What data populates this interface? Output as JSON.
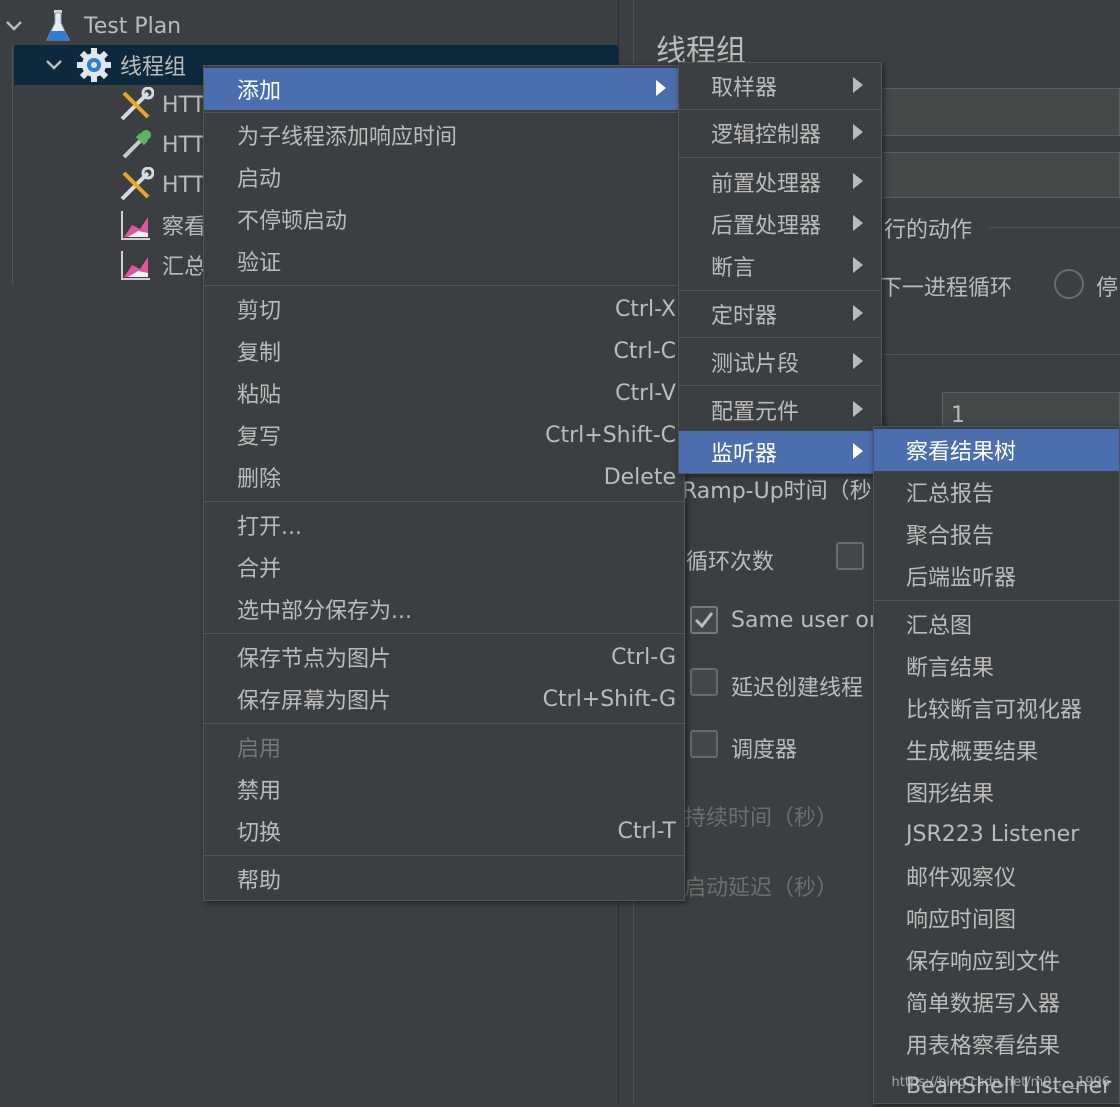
{
  "tree": {
    "root_label": "Test Plan",
    "thread_group_label": "线程组",
    "children": [
      {
        "label": "HTT",
        "icon": "sampler-tools-icon"
      },
      {
        "label": "HTT",
        "icon": "pipette-icon"
      },
      {
        "label": "HTT",
        "icon": "sampler-tools-icon"
      },
      {
        "label": "察看",
        "icon": "listener-chart-icon"
      },
      {
        "label": "汇总",
        "icon": "listener-chart-icon"
      }
    ]
  },
  "right_panel": {
    "title": "线程组",
    "action_group_label": "行的动作",
    "next_loop_label": "下一进程循环",
    "stop_label": "停",
    "threads_value": "1",
    "rampup_label": "Ramp-Up时间（秒",
    "loop_label": "循环次数",
    "same_user_label": "Same user on",
    "delay_label": "延迟创建线程",
    "scheduler_label": "调度器",
    "duration_label": "持续时间（秒）",
    "startup_delay_label": "启动延迟（秒）"
  },
  "context_menu": {
    "items": [
      {
        "label": "添加",
        "submenu": true,
        "highlight": true
      },
      {
        "label": "为子线程添加响应时间"
      },
      {
        "label": "启动"
      },
      {
        "label": "不停顿启动"
      },
      {
        "label": "验证"
      },
      {
        "label": "剪切",
        "shortcut": "Ctrl-X"
      },
      {
        "label": "复制",
        "shortcut": "Ctrl-C"
      },
      {
        "label": "粘贴",
        "shortcut": "Ctrl-V"
      },
      {
        "label": "复写",
        "shortcut": "Ctrl+Shift-C"
      },
      {
        "label": "删除",
        "shortcut": "Delete"
      },
      {
        "label": "打开..."
      },
      {
        "label": "合并"
      },
      {
        "label": "选中部分保存为..."
      },
      {
        "label": "保存节点为图片",
        "shortcut": "Ctrl-G"
      },
      {
        "label": "保存屏幕为图片",
        "shortcut": "Ctrl+Shift-G"
      },
      {
        "label": "启用",
        "disabled": true
      },
      {
        "label": "禁用"
      },
      {
        "label": "切换",
        "shortcut": "Ctrl-T"
      },
      {
        "label": "帮助"
      }
    ]
  },
  "add_submenu": {
    "items": [
      {
        "label": "取样器"
      },
      {
        "label": "逻辑控制器"
      },
      {
        "label": "前置处理器"
      },
      {
        "label": "后置处理器"
      },
      {
        "label": "断言"
      },
      {
        "label": "定时器"
      },
      {
        "label": "测试片段"
      },
      {
        "label": "配置元件"
      },
      {
        "label": "监听器",
        "highlight": true
      }
    ]
  },
  "listener_submenu": {
    "items": [
      {
        "label": "察看结果树",
        "highlight": true
      },
      {
        "label": "汇总报告"
      },
      {
        "label": "聚合报告"
      },
      {
        "label": "后端监听器"
      },
      {
        "label": "汇总图"
      },
      {
        "label": "断言结果"
      },
      {
        "label": "比较断言可视化器"
      },
      {
        "label": "生成概要结果"
      },
      {
        "label": "图形结果"
      },
      {
        "label": "JSR223 Listener"
      },
      {
        "label": "邮件观察仪"
      },
      {
        "label": "响应时间图"
      },
      {
        "label": "保存响应到文件"
      },
      {
        "label": "简单数据写入器"
      },
      {
        "label": "用表格察看结果"
      },
      {
        "label": "BeanShell Listener"
      }
    ]
  },
  "watermark": "https://blog.csdn.net/m0_..._1996",
  "colors": {
    "background": "#3c3f41",
    "menu_highlight": "#4b6eaf",
    "tree_selection": "#0d293e",
    "text": "#bbbbbb"
  }
}
